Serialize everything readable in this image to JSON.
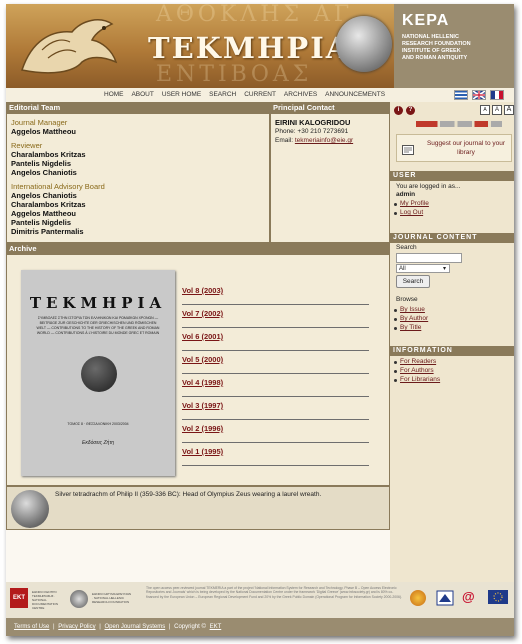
{
  "header": {
    "site_title": "ΤΕΚΜΗΡΙΑ",
    "institute": {
      "name": "KEPA",
      "lines": [
        "NATIONAL HELLENIC",
        "RESEARCH FOUNDATION",
        "INSTITUTE OF GREEK",
        "AND ROMAN ANTIQUITY"
      ]
    }
  },
  "nav": {
    "items": [
      "HOME",
      "ABOUT",
      "USER HOME",
      "SEARCH",
      "CURRENT",
      "ARCHIVES",
      "ANNOUNCEMENTS"
    ]
  },
  "editorial": {
    "title": "Editorial Team",
    "groups": [
      {
        "role": "Journal Manager",
        "people": [
          "Aggelos Mattheou"
        ]
      },
      {
        "role": "Reviewer",
        "people": [
          "Charalambos Kritzas",
          "Pantelis Nigdelis",
          "Angelos Chaniotis"
        ]
      },
      {
        "role": "International Advisory Board",
        "people": [
          "Angelos Chaniotis",
          "Charalambos Kritzas",
          "Aggelos Mattheou",
          "Pantelis Nigdelis",
          "Dimitris Pantermalis"
        ]
      }
    ]
  },
  "contact": {
    "title": "Principal Contact",
    "name": "EIRINI KALOGRIDOU",
    "phone": "Phone: +30 210 7273691",
    "email_label": "Email:",
    "email": "tekmeriainfo@eie.gr"
  },
  "archive": {
    "title": "Archive",
    "cover": {
      "title": "ΤΕΚΜΗΡΙΑ",
      "subtitle": "ΣΥΜΒΟΛΕΣ ΣΤΗΝ ΙΣΤΟΡΙΑ ΤΩΝ ΕΛΛΗΝΙΚΩΝ ΚΑΙ ΡΩΜΑΪΚΩΝ ΧΡΟΝΩΝ — BEITRÄGE ZUR GESCHICHTE DER GRIECHISCHEN UND RÖMISCHEN WELT — CONTRIBUTIONS TO THE HISTORY OF THE GREEK AND ROMAN WORLD — CONTRIBUTIONS À L'HISTOIRE DU MONDE GREC ET ROMAIN",
      "volume": "ΤΟΜΟΣ 8 · ΘΕΣΣΑΛΟΝΙΚΗ 2003/2004",
      "publisher": "Εκδόσεις Ζήτη"
    },
    "volumes": [
      "Vol 8 (2003)",
      "Vol 7 (2002)",
      "Vol 6 (2001)",
      "Vol 5 (2000)",
      "Vol 4 (1998)",
      "Vol 3 (1997)",
      "Vol 2 (1996)",
      "Vol 1 (1995)"
    ],
    "caption": "Silver tetradrachm of Philip II (359-336 BC): Head of Olympius Zeus wearing a laurel wreath."
  },
  "sidebar": {
    "font_sizes": [
      "A",
      "A",
      "A"
    ],
    "suggest": "Suggest our journal to your library",
    "user": {
      "title": "USER",
      "logged_in": "You are logged in as...",
      "username": "admin",
      "links": [
        "My Profile",
        "Log Out"
      ]
    },
    "journal_content": {
      "title": "JOURNAL CONTENT",
      "search_label": "Search",
      "search_value": "",
      "scope_value": "All",
      "search_button": "Search",
      "browse_label": "Browse",
      "browse_links": [
        "By Issue",
        "By Author",
        "By Title"
      ]
    },
    "information": {
      "title": "INFORMATION",
      "links": [
        "For Readers",
        "For Authors",
        "For Librarians"
      ]
    }
  },
  "footer": {
    "logo_ekt": "EKT",
    "logo_ekt_text": "ΕΘΝΙΚΟ ΚΕΝΤΡΟ ΤΕΚΜΗΡΙΩΣΗΣ · NATIONAL DOCUMENTATION CENTRE",
    "logo_eie_text": "ΕΘΝΙΚΟ ΙΔΡΥΜΑ ΕΡΕΥΝΩΝ · NATIONAL HELLENIC RESEARCH FOUNDATION",
    "notice": "The open access peer-reviewed journal TEKMERIA a part of the project 'National Information System for Research and Technology, Phase B – Open Access Electronic Repositories and Journals' which is being developed by the National Documentation Centre under the framework 'Digital Greece' (www.infosociety.gr) and is 80% co-financed by the European Union – European Regional Development Fund and 20% by the Greek Public Domain (Operational Program for Information Society 2000-2006).",
    "links": [
      "Terms of Use",
      "Privacy Policy",
      "Open Journal Systems"
    ],
    "copyright": "Copyright ©",
    "copyright_link": "EKT"
  },
  "colors": {
    "section_bar": "#8a7a5a",
    "panel": "#f3ecd8",
    "link": "#6b1b1b",
    "header_gold": "#b07a38"
  }
}
